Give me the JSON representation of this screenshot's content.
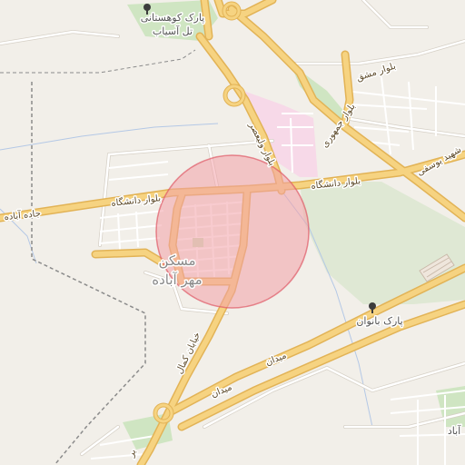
{
  "map": {
    "colors": {
      "background": "#f2efe9",
      "road_major": "#f6d381",
      "road_major_casing": "#e2b356",
      "road_minor": "#ffffff",
      "road_minor_casing": "#d6d0c6",
      "park": "#cfe5c2",
      "green_field": "#dfe8d4",
      "hospital_area": "#f7d9e8",
      "highlight_fill": "#f3a1a8",
      "highlight_stroke": "#e05a66",
      "boundary": "#8b8b8b",
      "water_line": "#b4c8e6",
      "label_text": "#555555"
    },
    "labels": {
      "park_kuhestani_1": "پارک کوهستانی",
      "park_kuhestani_2": "تل آسیاب",
      "blvd_mashq": "بلوار مشق",
      "blvd_jomhouri": "بلوار جمهوری",
      "blvd_valiasr": "بلوار ولیعصر",
      "blvd_daneshgah_east": "بلوار دانشگاه",
      "blvd_daneshgah_west": "بلوار دانشگاه",
      "jadeh_abadeh": "جاده آباده",
      "shahid_yousefi": "شهید یوسفی",
      "maskan_1": "مسکن",
      "maskan_2": "مهر آباده",
      "khiaban_kamal": "خیابان کمال",
      "park_banoovan": "پارک بانوان",
      "meydan_1": "میدان",
      "meydan_2": "میدان",
      "abad": "آباد",
      "bottom_road": "بر"
    },
    "icons": [
      "tree-icon",
      "tree-icon"
    ]
  }
}
